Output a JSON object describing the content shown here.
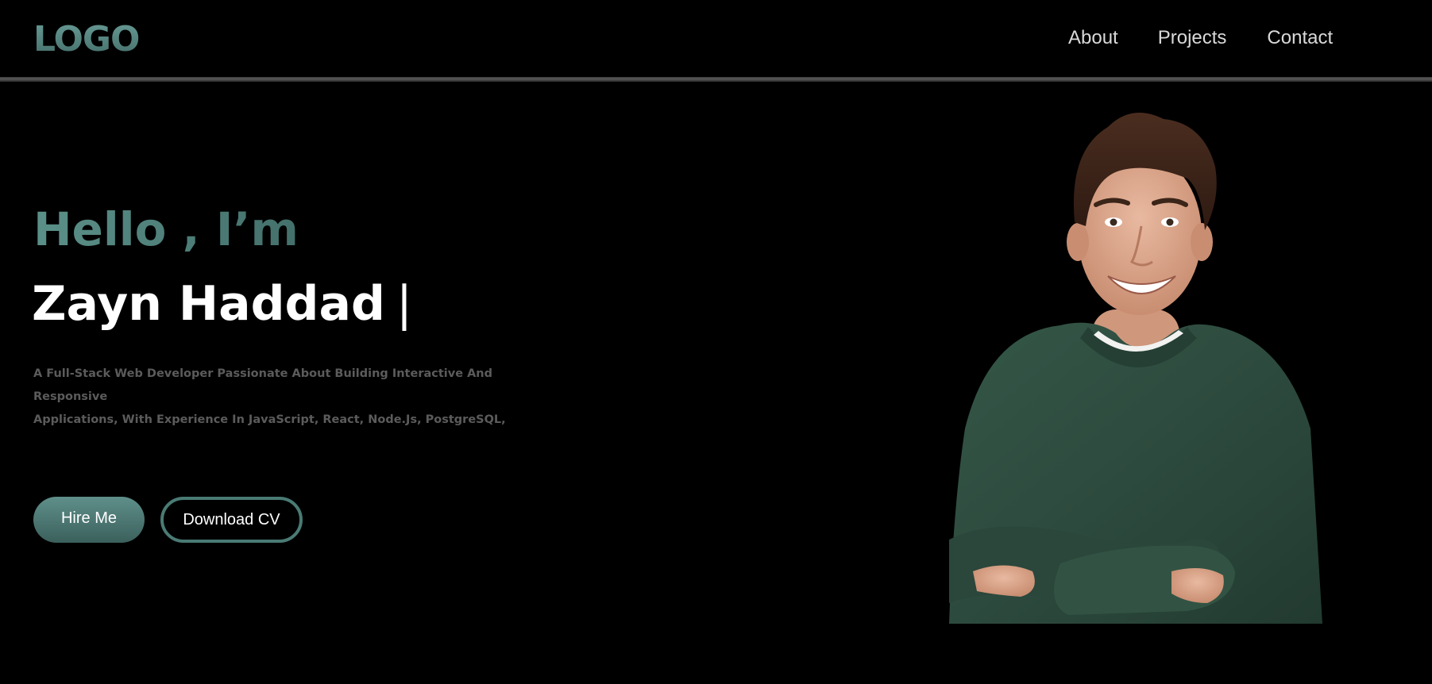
{
  "header": {
    "logo": "LOGO",
    "nav": {
      "about": "About",
      "projects": "Projects",
      "contact": "Contact"
    }
  },
  "hero": {
    "greeting": "Hello , I’m",
    "name": "Zayn Haddad",
    "cursor": "|",
    "description_line1": "A Full-Stack Web Developer Passionate About Building Interactive And Responsive",
    "description_line2": "Applications, With Experience In JavaScript, React, Node.Js, PostgreSQL,",
    "hire_button": "Hire Me",
    "cv_button": "Download CV"
  },
  "colors": {
    "background": "#000000",
    "accent": "#4f807a",
    "nav_text": "#d9d9d9",
    "description": "#5b5b5b",
    "sweater": "#2f4d41"
  },
  "icons": {
    "portrait": "person-portrait"
  }
}
